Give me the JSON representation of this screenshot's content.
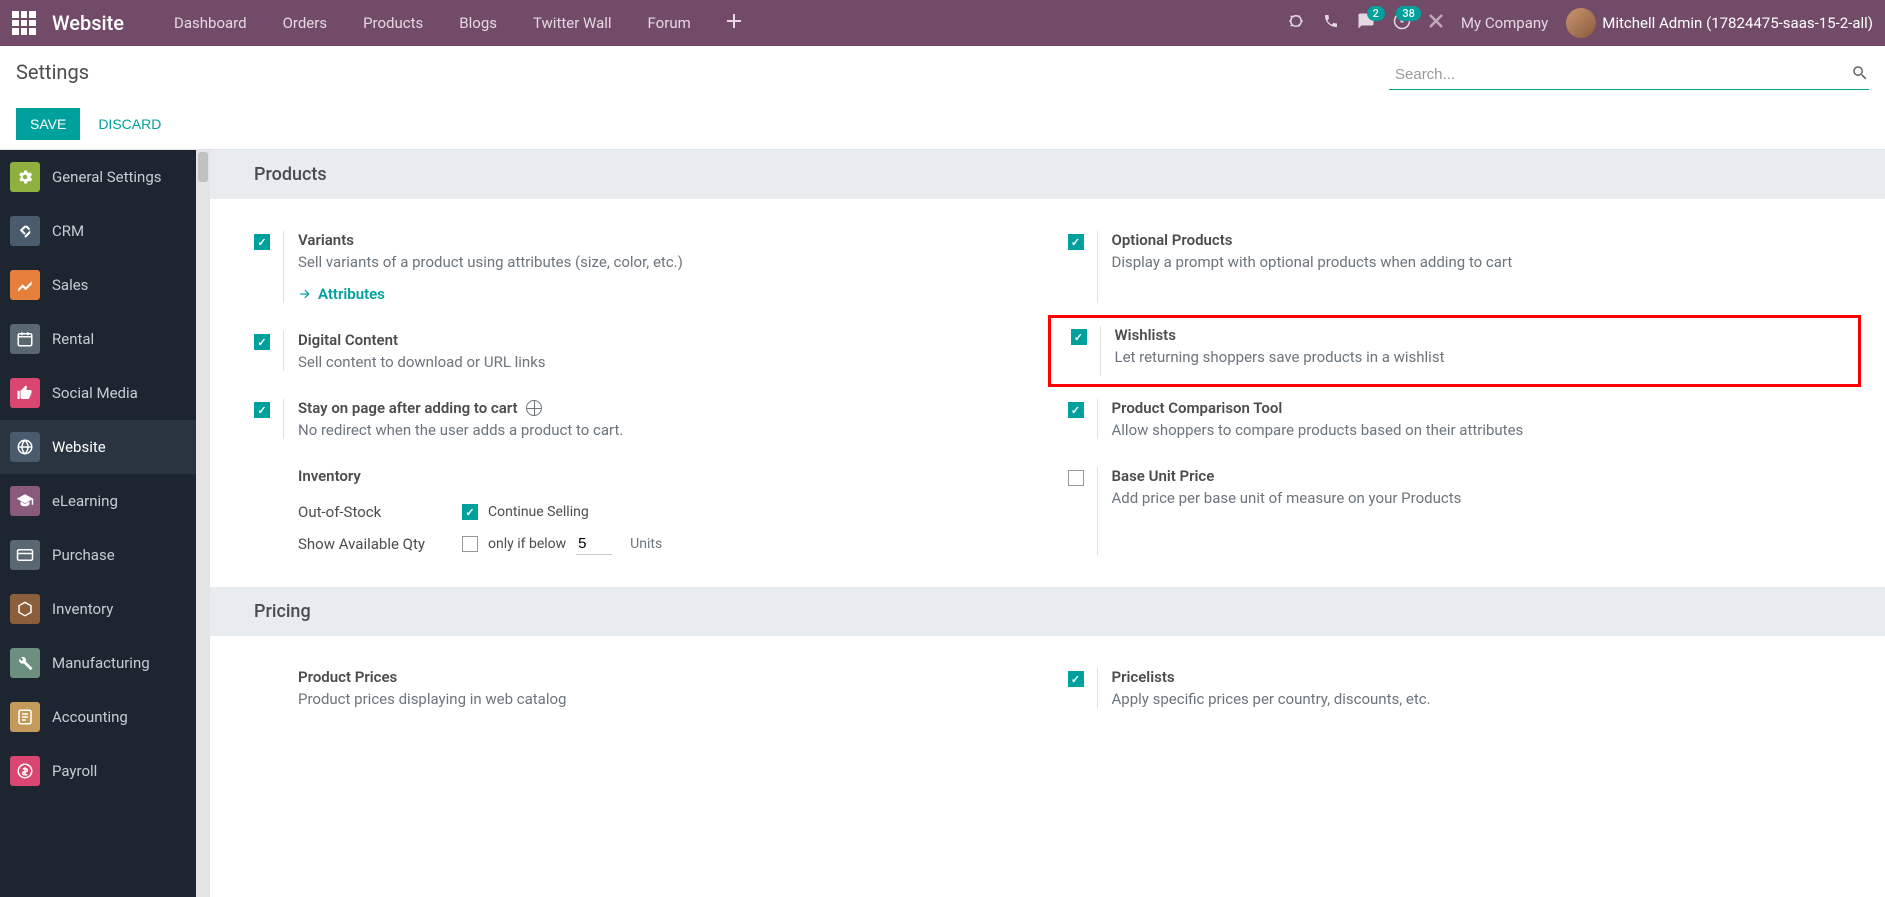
{
  "topNav": {
    "appName": "Website",
    "items": [
      "Dashboard",
      "Orders",
      "Products",
      "Blogs",
      "Twitter Wall",
      "Forum"
    ],
    "chatBadge": "2",
    "activityBadge": "38",
    "company": "My Company",
    "user": "Mitchell Admin (17824475-saas-15-2-all)"
  },
  "controlPanel": {
    "title": "Settings",
    "searchPlaceholder": "Search...",
    "saveLabel": "SAVE",
    "discardLabel": "DISCARD"
  },
  "sidebar": {
    "items": [
      {
        "label": "General Settings",
        "icon": "gear",
        "bg": "#8fb03e"
      },
      {
        "label": "CRM",
        "icon": "handshake",
        "bg": "#4a5b6d"
      },
      {
        "label": "Sales",
        "icon": "chart",
        "bg": "#e67e3c"
      },
      {
        "label": "Rental",
        "icon": "calendar",
        "bg": "#5b6770"
      },
      {
        "label": "Social Media",
        "icon": "thumb",
        "bg": "#d9466f"
      },
      {
        "label": "Website",
        "icon": "globe",
        "bg": "#4a5b6d"
      },
      {
        "label": "eLearning",
        "icon": "graduation",
        "bg": "#8a5a7d"
      },
      {
        "label": "Purchase",
        "icon": "card",
        "bg": "#5b6770"
      },
      {
        "label": "Inventory",
        "icon": "box",
        "bg": "#8b5e3c"
      },
      {
        "label": "Manufacturing",
        "icon": "wrench",
        "bg": "#6b9080"
      },
      {
        "label": "Accounting",
        "icon": "ledger",
        "bg": "#c49a5a"
      },
      {
        "label": "Payroll",
        "icon": "money",
        "bg": "#d9466f"
      }
    ]
  },
  "sections": {
    "products": {
      "title": "Products",
      "variants": {
        "title": "Variants",
        "desc": "Sell variants of a product using attributes (size, color, etc.)",
        "link": "Attributes"
      },
      "optionalProducts": {
        "title": "Optional Products",
        "desc": "Display a prompt with optional products when adding to cart"
      },
      "digitalContent": {
        "title": "Digital Content",
        "desc": "Sell content to download or URL links"
      },
      "wishlists": {
        "title": "Wishlists",
        "desc": "Let returning shoppers save products in a wishlist"
      },
      "stayOnPage": {
        "title": "Stay on page after adding to cart",
        "desc": "No redirect when the user adds a product to cart."
      },
      "comparisonTool": {
        "title": "Product Comparison Tool",
        "desc": "Allow shoppers to compare products based on their attributes"
      },
      "baseUnitPrice": {
        "title": "Base Unit Price",
        "desc": "Add price per base unit of measure on your Products"
      },
      "inventory": {
        "title": "Inventory",
        "outOfStock": "Out-of-Stock",
        "continueSelling": "Continue Selling",
        "showAvailable": "Show Available Qty",
        "onlyBelow": "only if below",
        "qtyValue": "5",
        "units": "Units"
      }
    },
    "pricing": {
      "title": "Pricing",
      "productPrices": {
        "title": "Product Prices",
        "desc": "Product prices displaying in web catalog"
      },
      "pricelists": {
        "title": "Pricelists",
        "desc": "Apply specific prices per country, discounts, etc."
      }
    }
  }
}
